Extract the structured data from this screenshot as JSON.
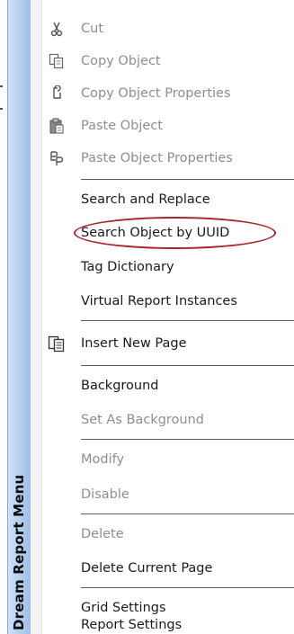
{
  "sidebar": {
    "title": "Dream Report Menu"
  },
  "menu": {
    "items": [
      {
        "label": "Cut",
        "icon": "scissors-icon",
        "enabled": false
      },
      {
        "label": "Copy Object",
        "icon": "copy-icon",
        "enabled": false
      },
      {
        "label": "Copy Object Properties",
        "icon": "copy-properties-icon",
        "enabled": false
      },
      {
        "label": "Paste Object",
        "icon": "clipboard-icon",
        "enabled": false
      },
      {
        "label": "Paste Object Properties",
        "icon": "paste-properties-icon",
        "enabled": false
      },
      {
        "label": "Search and Replace",
        "enabled": true
      },
      {
        "label": "Search Object by UUID",
        "enabled": true,
        "highlighted": true
      },
      {
        "label": "Tag Dictionary",
        "enabled": true
      },
      {
        "label": "Virtual Report Instances",
        "enabled": true
      },
      {
        "label": "Insert New Page",
        "icon": "new-page-icon",
        "enabled": true
      },
      {
        "label": "Background",
        "enabled": true
      },
      {
        "label": "Set As Background",
        "enabled": false
      },
      {
        "label": "Modify",
        "enabled": false
      },
      {
        "label": "Disable",
        "enabled": false
      },
      {
        "label": "Delete",
        "enabled": false
      },
      {
        "label": "Delete Current Page",
        "enabled": true
      },
      {
        "label": "Grid Settings",
        "enabled": true
      },
      {
        "label": "Report Settings",
        "enabled": true
      }
    ]
  },
  "colors": {
    "highlight": "#a8222b",
    "disabled_text": "#8e8e8e",
    "band": "#b5d0ee"
  }
}
